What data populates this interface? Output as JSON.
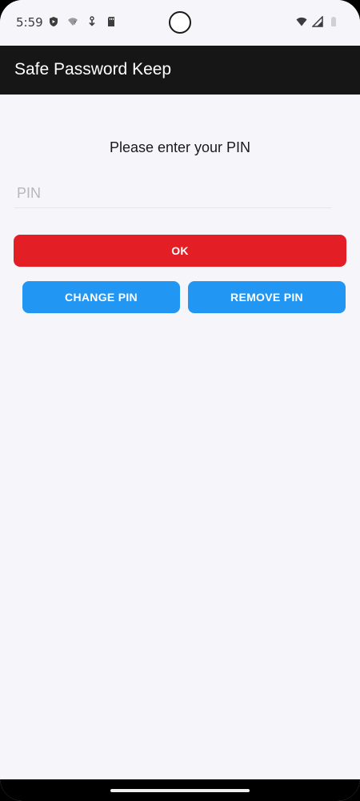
{
  "status_bar": {
    "time": "5:59",
    "left_icons": [
      "shield-icon",
      "wifi-question-icon",
      "download-icon",
      "sd-card-icon"
    ],
    "right_icons": [
      "wifi-icon",
      "signal-icon",
      "battery-icon"
    ]
  },
  "app_bar": {
    "title": "Safe Password Keep",
    "background": "#161616"
  },
  "main": {
    "prompt": "Please enter your PIN",
    "pin_field": {
      "placeholder": "PIN",
      "value": ""
    },
    "ok_button": {
      "label": "OK",
      "color": "#e31e24"
    },
    "change_pin_button": {
      "label": "CHANGE PIN",
      "color": "#2196f3"
    },
    "remove_pin_button": {
      "label": "REMOVE PIN",
      "color": "#2196f3"
    }
  }
}
